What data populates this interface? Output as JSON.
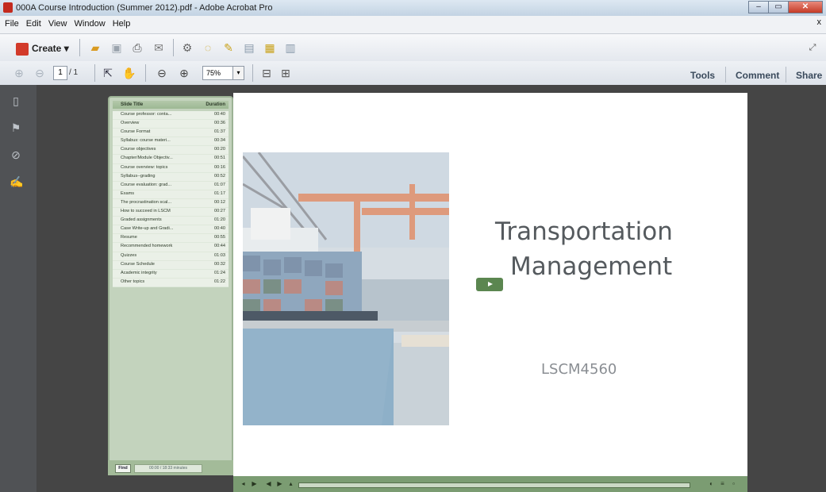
{
  "window": {
    "title": "000A Course Introduction (Summer 2012).pdf - Adobe Acrobat Pro",
    "controls": [
      "minimize",
      "maximize",
      "close"
    ]
  },
  "menubar": {
    "items": [
      "File",
      "Edit",
      "View",
      "Window",
      "Help"
    ],
    "close_glyph": "x"
  },
  "toolbar": {
    "create_label": "Create",
    "create_arrow": "▾"
  },
  "pagenav": {
    "current_page": "1",
    "total_pages": "/ 1",
    "zoom": "75%",
    "zoom_arrow": "▾"
  },
  "right_tabs": {
    "tools": "Tools",
    "comment": "Comment",
    "share": "Share"
  },
  "outline": {
    "col_title": "Slide Title",
    "col_duration": "Duration",
    "rows": [
      {
        "title": "Course professor: conta...",
        "duration": "00:40"
      },
      {
        "title": "Overview",
        "duration": "00:36"
      },
      {
        "title": "Course Format",
        "duration": "01:37"
      },
      {
        "title": "Syllabus: course materi...",
        "duration": "00:34"
      },
      {
        "title": "Course objectives",
        "duration": "00:20"
      },
      {
        "title": "Chapter/Module Objectiv...",
        "duration": "00:51"
      },
      {
        "title": "Course overview: topics",
        "duration": "00:16"
      },
      {
        "title": "Syllabus--grading",
        "duration": "00:52"
      },
      {
        "title": "Course evaluation: grad...",
        "duration": "01:07"
      },
      {
        "title": "Exams",
        "duration": "01:17"
      },
      {
        "title": "The procrastination scal...",
        "duration": "00:12"
      },
      {
        "title": "How to succeed in LSCM",
        "duration": "00:27"
      },
      {
        "title": "Graded assignments",
        "duration": "01:20"
      },
      {
        "title": "Case Write-up and Gradi...",
        "duration": "00:40"
      },
      {
        "title": "Resume",
        "duration": "00:55"
      },
      {
        "title": "Recommended homework",
        "duration": "00:44"
      },
      {
        "title": "Quizzes",
        "duration": "01:03"
      },
      {
        "title": "Course Schedule",
        "duration": "00:32"
      },
      {
        "title": "Academic integrity",
        "duration": "01:24"
      },
      {
        "title": "Other topics",
        "duration": "01:22"
      }
    ],
    "find_label": "Find",
    "time_display": "00:00 / 18:33 minutes"
  },
  "slide": {
    "title_line1": "Transportation",
    "title_line2": "Management",
    "subtitle": "LSCM4560"
  },
  "colors": {
    "outline_bg": "#c3d3bd",
    "player_bar": "#7b9c72",
    "slide_text": "#555a5e"
  },
  "icons": [
    "create-icon",
    "open-folder-icon",
    "save-icon",
    "print-icon",
    "email-icon",
    "gear-icon",
    "comment-icon",
    "highlight-icon",
    "share-icon",
    "page-up-icon",
    "page-down-icon",
    "select-tool-icon",
    "hand-tool-icon",
    "zoom-out-icon",
    "zoom-in-icon",
    "fit-page-icon",
    "full-screen-icon",
    "pages-panel-icon",
    "bookmarks-icon",
    "attachments-icon",
    "signatures-icon",
    "expand-icon",
    "play-icon"
  ]
}
